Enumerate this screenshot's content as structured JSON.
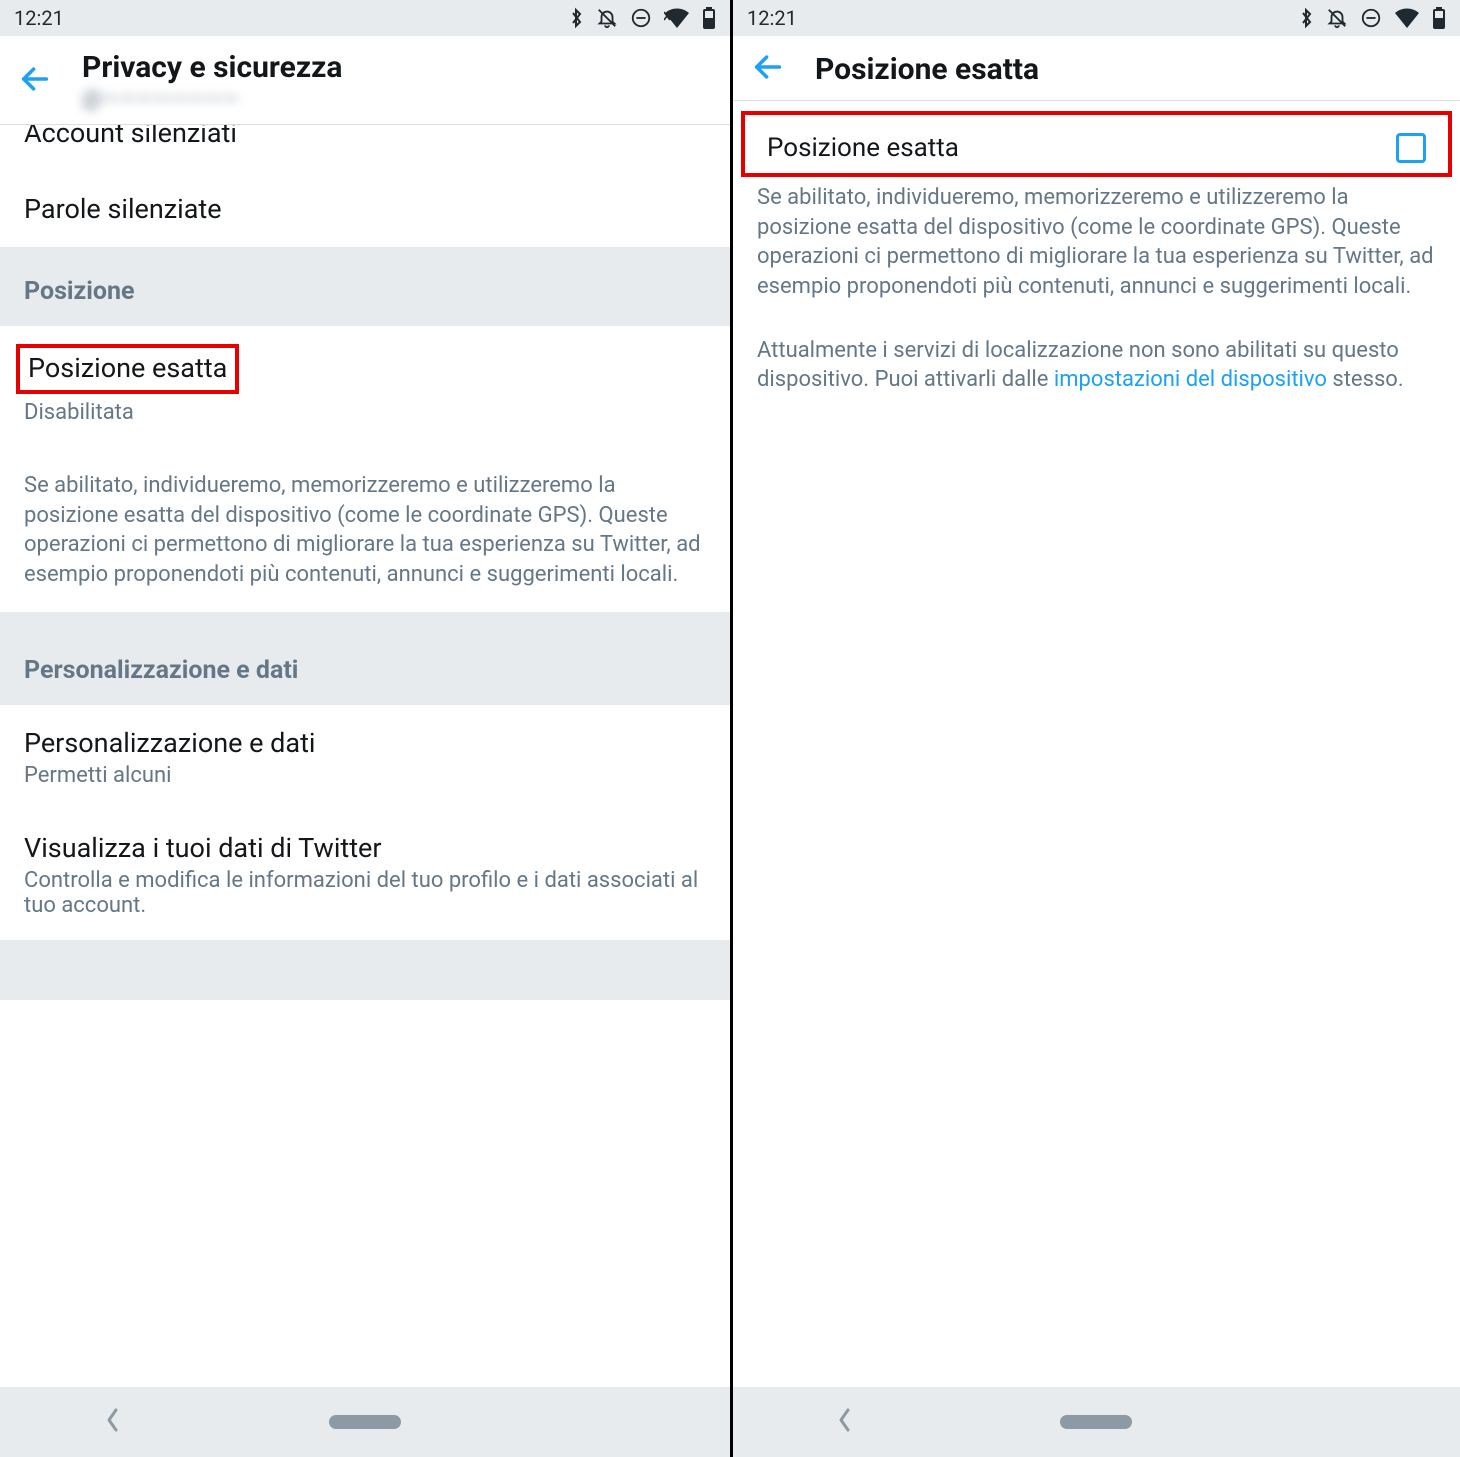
{
  "status": {
    "time": "12:21"
  },
  "left": {
    "title": "Privacy e sicurezza",
    "handle_prefix": "@",
    "handle_blur": "————————",
    "item_cut": "Account silenziati",
    "item_muted_words": "Parole silenziate",
    "section_position": "Posizione",
    "precise_location_title": "Posizione esatta",
    "precise_location_status": "Disabilitata",
    "precise_location_desc": "Se abilitato, individueremo, memorizzeremo e utilizzeremo la posizione esatta del dispositivo (come le coordinate GPS). Queste operazioni ci permettono di migliorare la tua esperienza su Twitter, ad esempio proponendoti più contenuti, annunci e suggerimenti locali.",
    "section_personalization": "Personalizzazione e dati",
    "personalization_title": "Personalizzazione e dati",
    "personalization_status": "Permetti alcuni",
    "twitter_data_title": "Visualizza i tuoi dati di Twitter",
    "twitter_data_desc": "Controlla e modifica le informazioni del tuo profilo e i dati associati al tuo account."
  },
  "right": {
    "title": "Posizione esatta",
    "toggle_label": "Posizione esatta",
    "desc1": "Se abilitato, individueremo, memorizzeremo e utilizzeremo la posizione esatta del dispositivo (come le coordinate GPS). Queste operazioni ci permettono di migliorare la tua esperienza su Twitter, ad esempio proponendoti più contenuti, annunci e suggerimenti locali.",
    "desc2_pre": "Attualmente i servizi di localizzazione non sono abilitati su questo dispositivo. Puoi attivarli dalle ",
    "desc2_link": "impostazioni del dispositivo",
    "desc2_post": " stesso."
  }
}
